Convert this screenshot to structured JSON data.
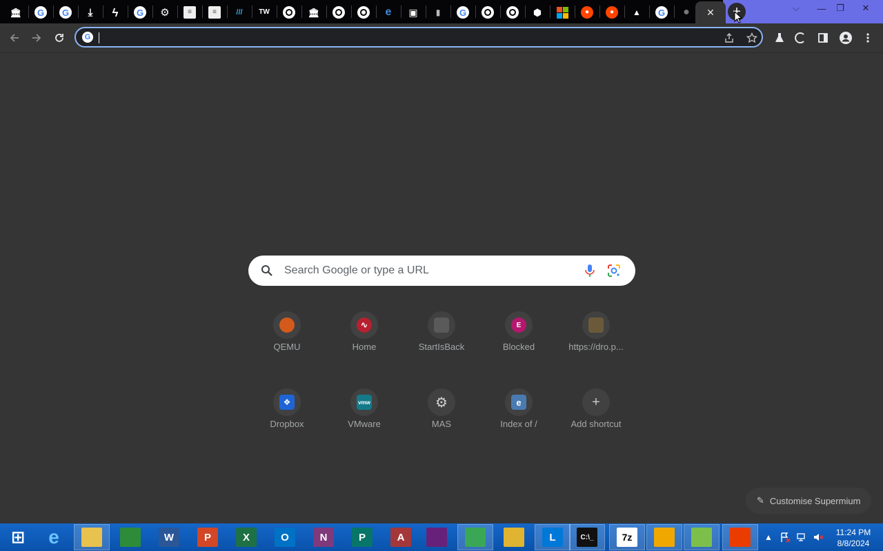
{
  "browser": {
    "tabs": [
      {
        "icon": "museum-icon"
      },
      {
        "icon": "google-icon"
      },
      {
        "icon": "google-icon"
      },
      {
        "icon": "download-icon"
      },
      {
        "icon": "bolt-icon"
      },
      {
        "icon": "google-icon"
      },
      {
        "icon": "gear-icon"
      },
      {
        "icon": "document-icon"
      },
      {
        "icon": "document-icon"
      },
      {
        "icon": "lines-icon"
      },
      {
        "icon": "tw-icon"
      },
      {
        "icon": "chrome-icon"
      },
      {
        "icon": "museum-icon"
      },
      {
        "icon": "chrome-icon"
      },
      {
        "icon": "chrome-icon"
      },
      {
        "icon": "ie-icon"
      },
      {
        "icon": "screen-icon"
      },
      {
        "icon": "startisback-icon"
      },
      {
        "icon": "google-icon"
      },
      {
        "icon": "chrome-icon"
      },
      {
        "icon": "chrome-icon"
      },
      {
        "icon": "box-icon"
      },
      {
        "icon": "microsoft-icon"
      },
      {
        "icon": "reddit-icon"
      },
      {
        "icon": "reddit-icon"
      },
      {
        "icon": "flask-icon"
      },
      {
        "icon": "google-icon"
      },
      {
        "icon": "globe-icon"
      }
    ],
    "tw_text": "TW",
    "active_tab_close": "✕",
    "new_tab": "+",
    "window_controls": {
      "dropdown": "⌵",
      "minimize": "—",
      "restore": "❐",
      "close": "✕"
    },
    "omnibox": {
      "value": "",
      "placeholder": ""
    }
  },
  "ntp": {
    "search_placeholder": "Search Google or type a URL",
    "shortcuts_row1": [
      {
        "label": "QEMU",
        "icon": "qemu-icon",
        "color": "#d45a1c"
      },
      {
        "label": "Home",
        "icon": "wave-icon",
        "color": "#b8202f"
      },
      {
        "label": "StartIsBack",
        "icon": "startisback-icon",
        "color": "#5a5a5a"
      },
      {
        "label": "Blocked",
        "icon": "letter-e-icon",
        "color": "#b4176e",
        "letter": "E"
      },
      {
        "label": "https://dro.p...",
        "icon": "boot-icon",
        "color": "#6b5a3a"
      }
    ],
    "shortcuts_row2": [
      {
        "label": "Dropbox",
        "icon": "dropbox-icon",
        "color": "#1f64d6"
      },
      {
        "label": "VMware",
        "icon": "vmware-icon",
        "color": "#147a8a",
        "letter": "vmw"
      },
      {
        "label": "MAS",
        "icon": "gear-icon",
        "color": "#777777"
      },
      {
        "label": "Index of /",
        "icon": "ie-icon",
        "color": "#4a7bb0"
      },
      {
        "label": "Add shortcut",
        "icon": "plus-icon",
        "color": "#414141",
        "letter": "+"
      }
    ],
    "customise_label": "Customise Supermium"
  },
  "taskbar": {
    "apps": [
      {
        "name": "start-button",
        "label": "⊞"
      },
      {
        "name": "internet-explorer",
        "label": "e"
      },
      {
        "name": "file-explorer",
        "label": ""
      },
      {
        "name": "project",
        "label": ""
      },
      {
        "name": "word",
        "label": "W"
      },
      {
        "name": "powerpoint",
        "label": "P"
      },
      {
        "name": "excel",
        "label": "X"
      },
      {
        "name": "outlook",
        "label": "O"
      },
      {
        "name": "onenote",
        "label": "N"
      },
      {
        "name": "publisher",
        "label": "P"
      },
      {
        "name": "access",
        "label": "A"
      },
      {
        "name": "visual-studio",
        "label": ""
      },
      {
        "name": "chrome",
        "label": ""
      },
      {
        "name": "bee",
        "label": ""
      },
      {
        "name": "lync",
        "label": "L"
      },
      {
        "name": "cmd",
        "label": "C:\\_"
      },
      {
        "name": "7zip",
        "label": "7z"
      },
      {
        "name": "hwinfo",
        "label": ""
      },
      {
        "name": "notepad-plus",
        "label": ""
      },
      {
        "name": "office",
        "label": ""
      }
    ],
    "time": "11:24 PM",
    "date": "8/8/2024"
  }
}
